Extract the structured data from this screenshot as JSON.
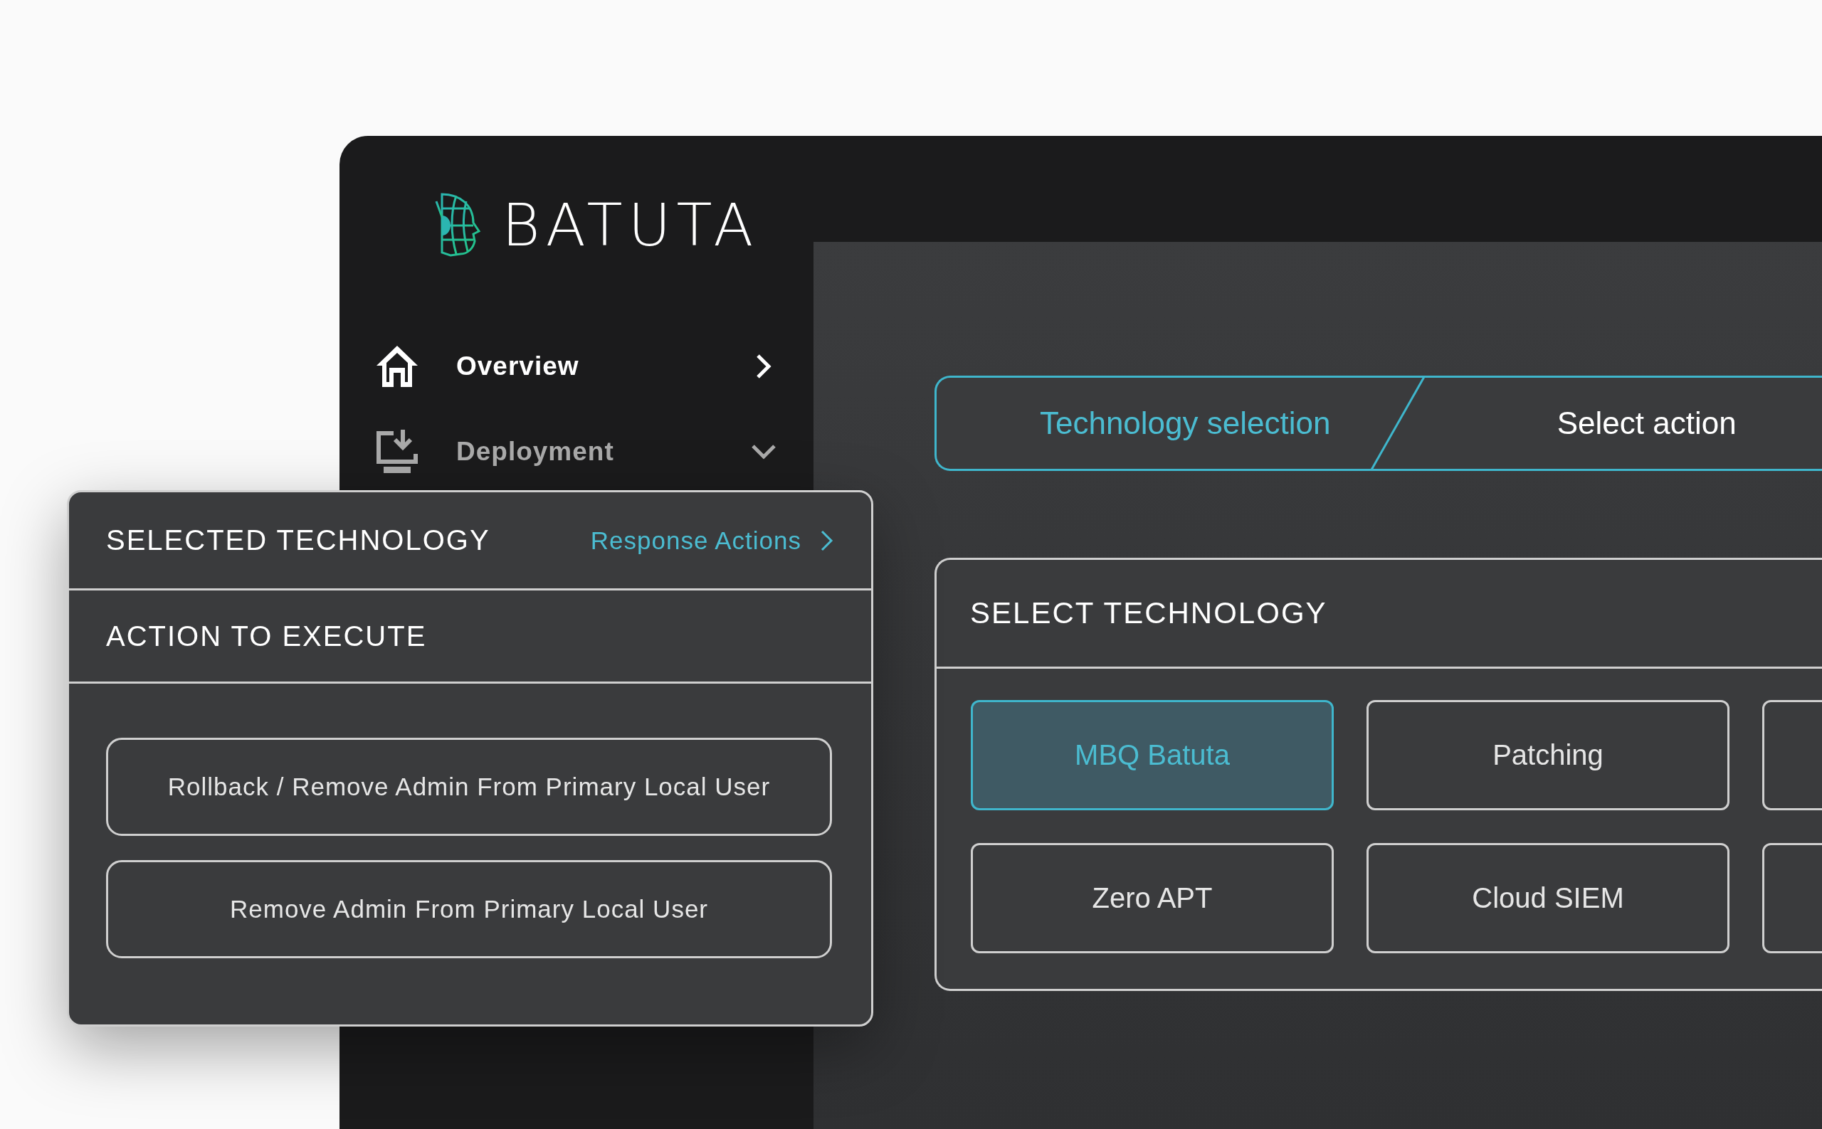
{
  "logo": {
    "name": "BATUTA"
  },
  "sidebar": {
    "items": [
      {
        "label": "Overview",
        "selected": true,
        "expanded": false,
        "kind": "home"
      },
      {
        "label": "Deployment",
        "selected": false,
        "expanded": true,
        "kind": "deploy"
      }
    ]
  },
  "stepper": {
    "steps": [
      {
        "label": "Technology selection",
        "selected": true
      },
      {
        "label": "Select action",
        "selected": false
      }
    ]
  },
  "select_technology": {
    "title": "SELECT TECHNOLOGY",
    "options": [
      {
        "label": "MBQ Batuta",
        "selected": true
      },
      {
        "label": "Patching",
        "selected": false
      },
      {
        "selected": false
      },
      {
        "label": "Zero APT",
        "selected": false
      },
      {
        "label": "Cloud SIEM",
        "selected": false
      },
      {
        "selected": false
      }
    ]
  },
  "overlay": {
    "title": "SELECTED TECHNOLOGY",
    "link": "Response Actions",
    "section": "ACTION TO EXECUTE",
    "actions": [
      "Rollback / Remove Admin From Primary Local User",
      "Remove Admin From Primary Local User"
    ]
  }
}
